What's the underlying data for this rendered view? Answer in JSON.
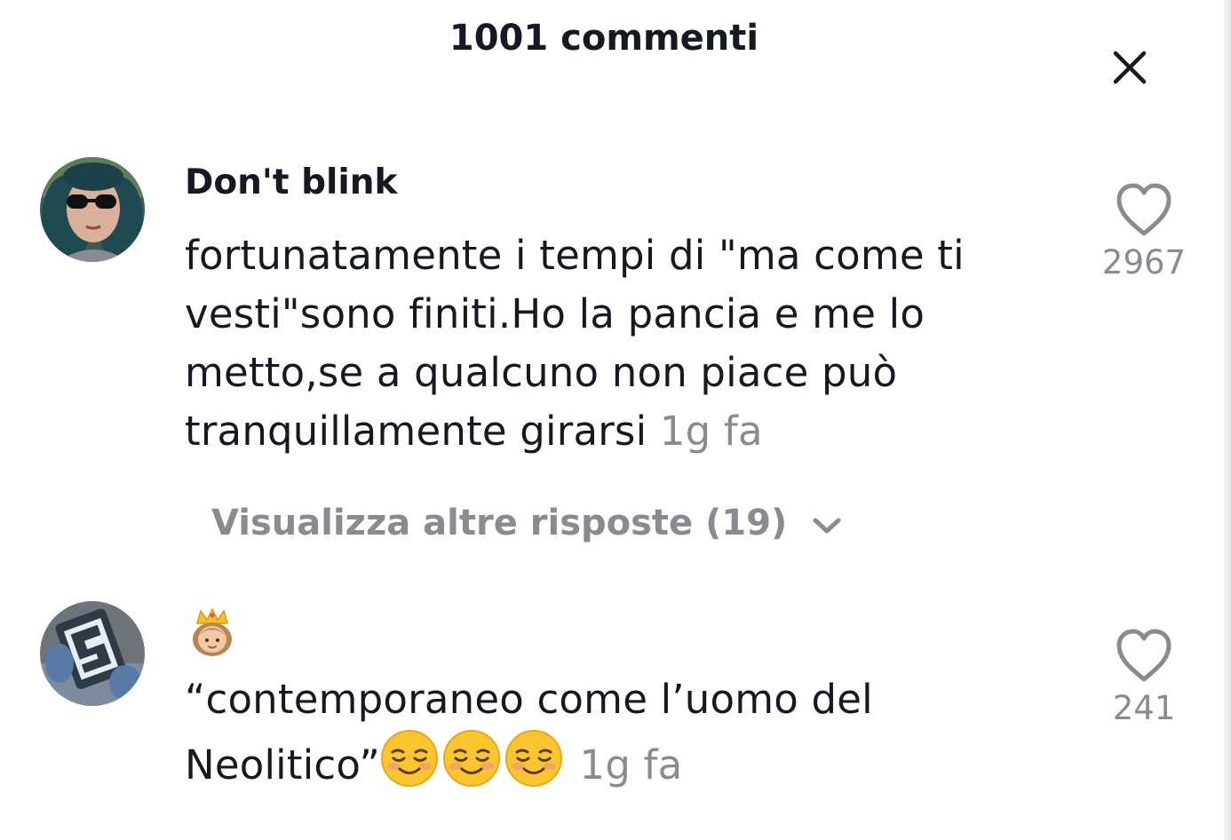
{
  "header": {
    "title": "1001 commenti"
  },
  "icons": {
    "close": "close-icon",
    "like": "heart-outline-icon",
    "expand": "chevron-down-icon",
    "crown_princess": "princess-emoji",
    "smiling": "smiling-face-emoji"
  },
  "colors": {
    "text_primary": "#161823",
    "text_secondary": "#8a8b91"
  },
  "comments": [
    {
      "username": "Don't blink",
      "text": "fortunatamente i tempi di \"ma come ti vesti\"sono finiti.Ho la pancia e me lo metto,se a qualcuno non piace può tranquillamente girarsi",
      "time": "1g fa",
      "likes": "2967",
      "replies_label": "Visualizza altre risposte (19)"
    },
    {
      "username": "",
      "text": "“contemporaneo come l’uomo del Neolitico”",
      "time": "1g fa",
      "likes": "241"
    }
  ]
}
